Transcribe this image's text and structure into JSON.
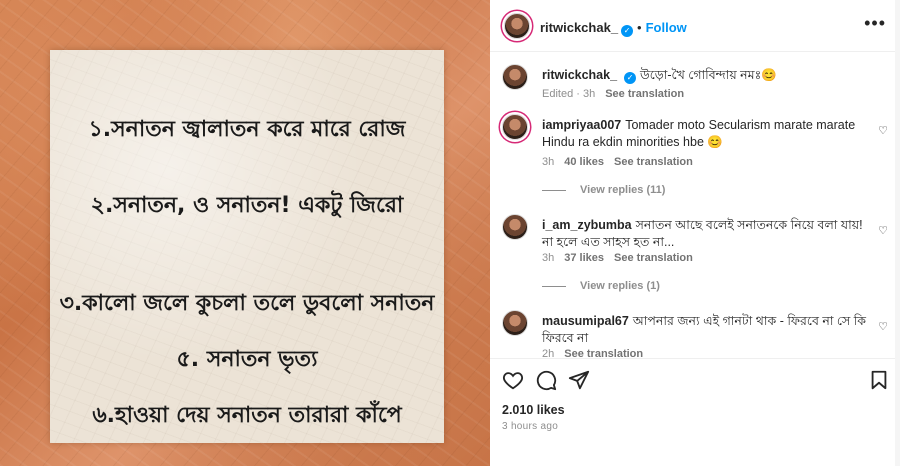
{
  "post": {
    "image_lines": [
      "১.সনাতন জ্বালাতন করে মারে রোজ",
      "২.সনাতন, ও সনাতন! একটু জিরো",
      "৩.কালো জলে কুচলা তলে ডুবলো সনাতন",
      "৫. সনাতন ভৃত্য",
      "৬.হাওয়া দেয় সনাতন তারারা কাঁপে"
    ]
  },
  "header": {
    "username": "ritwickchak_",
    "separator": "•",
    "follow_label": "Follow",
    "more": "•••"
  },
  "caption": {
    "username": "ritwickchak_",
    "text": "উড়ো-খৈ গোবিন্দায় নমঃ😊",
    "edited": "Edited · 3h",
    "see_translation": "See translation"
  },
  "comments": [
    {
      "username": "iampriyaa007",
      "text": "Tomader moto Secularism marate marate Hindu ra ekdin minorities hbe 😊",
      "time": "3h",
      "likes": "40 likes",
      "see_translation": "See translation",
      "replies": "View replies (11)"
    },
    {
      "username": "i_am_zybumba",
      "text": "সনাতন আছে বলেই সনাতনকে নিয়ে বলা যায়! না হলে এত সাহস হত না...",
      "time": "3h",
      "likes": "37 likes",
      "see_translation": "See translation",
      "replies": "View replies (1)"
    },
    {
      "username": "mausumipal67",
      "text": "আপনার জন্য এই গানটা থাক - ফিরবে না সে কি ফিরবে না",
      "time": "2h",
      "see_translation": "See translation"
    }
  ],
  "footer": {
    "likes": "2.010 likes",
    "time": "3 hours ago"
  }
}
